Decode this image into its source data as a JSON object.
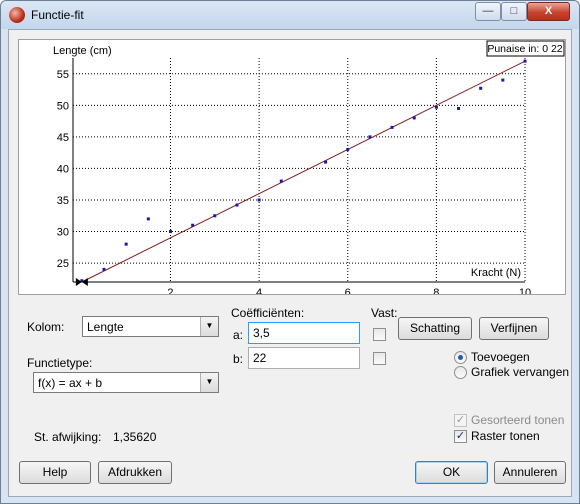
{
  "window": {
    "title": "Functie-fit",
    "minimize": "—",
    "maximize": "□",
    "close": "X"
  },
  "chart": {
    "ylabel": "Lengte (cm)",
    "xlabel": "Kracht (N)",
    "pushpin": "Punaise in: 0 22",
    "x_ticks": [
      "2",
      "4",
      "6",
      "8",
      "10"
    ],
    "y_ticks": [
      "25",
      "30",
      "35",
      "40",
      "45",
      "50",
      "55"
    ]
  },
  "chart_data": {
    "type": "scatter",
    "xlabel": "Kracht (N)",
    "ylabel": "Lengte (cm)",
    "xlim": [
      -0.2,
      10
    ],
    "ylim": [
      22,
      57.5
    ],
    "grid": true,
    "points": {
      "x": [
        0,
        0.5,
        1,
        1.5,
        2,
        2.5,
        3,
        3.5,
        4,
        4.5,
        5.5,
        6,
        6.5,
        7,
        7.5,
        8,
        8.5,
        9,
        9.5,
        10
      ],
      "y": [
        22.2,
        24,
        28,
        32,
        30,
        31,
        32.5,
        34.2,
        35,
        38,
        41,
        43,
        45,
        46.5,
        48,
        49.7,
        49.5,
        52.7,
        54,
        57
      ]
    },
    "fit_line": {
      "function": "f(x) = ax + b",
      "a": 3.5,
      "b": 22
    },
    "colors": {
      "points": "#1a1aa8",
      "fit": "#8b1a1a",
      "grid": "#000000"
    }
  },
  "controls": {
    "kolom_label": "Kolom:",
    "kolom_value": "Lengte",
    "functietype_label": "Functietype:",
    "functietype_value": "f(x) = ax + b",
    "coef_label": "Coëfficiënten:",
    "a_label": "a:",
    "a_value": "3,5",
    "b_label": "b:",
    "b_value": "22",
    "vast_label": "Vast:",
    "schatting": "Schatting",
    "verfijnen": "Verfijnen",
    "toevoegen": "Toevoegen",
    "grafiek_vervangen": "Grafiek vervangen",
    "gesorteerd": "Gesorteerd tonen",
    "raster": "Raster tonen",
    "afwijking_label": "St. afwijking:",
    "afwijking_value": "1,35620"
  },
  "footer": {
    "help": "Help",
    "afdrukken": "Afdrukken",
    "ok": "OK",
    "annuleren": "Annuleren"
  }
}
